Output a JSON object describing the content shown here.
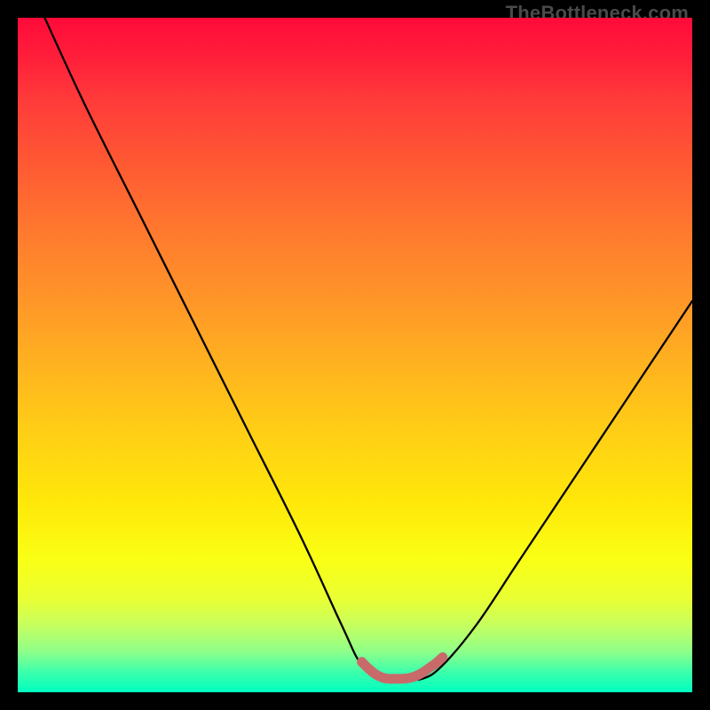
{
  "watermark": "TheBottleneck.com",
  "chart_data": {
    "type": "line",
    "title": "",
    "xlabel": "",
    "ylabel": "",
    "xlim": [
      0,
      100
    ],
    "ylim": [
      0,
      100
    ],
    "series": [
      {
        "name": "bottleneck-curve",
        "x": [
          4,
          10,
          18,
          26,
          34,
          42,
          48,
          51,
          54,
          57,
          60,
          63,
          68,
          74,
          80,
          86,
          92,
          100
        ],
        "y": [
          100,
          87,
          71,
          55,
          39,
          23,
          10,
          4,
          2,
          2,
          2,
          4,
          10,
          19,
          28,
          37,
          46,
          58
        ]
      }
    ],
    "highlight": {
      "name": "flat-bottom-highlight",
      "color": "#c96a6a",
      "x": [
        51,
        52,
        53,
        54,
        55,
        56,
        57,
        58,
        59,
        60,
        61,
        62,
        63
      ],
      "y": [
        4.5,
        3.5,
        2.7,
        2.2,
        2.0,
        2.0,
        2.0,
        2.1,
        2.4,
        2.9,
        3.6,
        4.3,
        5.2
      ]
    }
  }
}
